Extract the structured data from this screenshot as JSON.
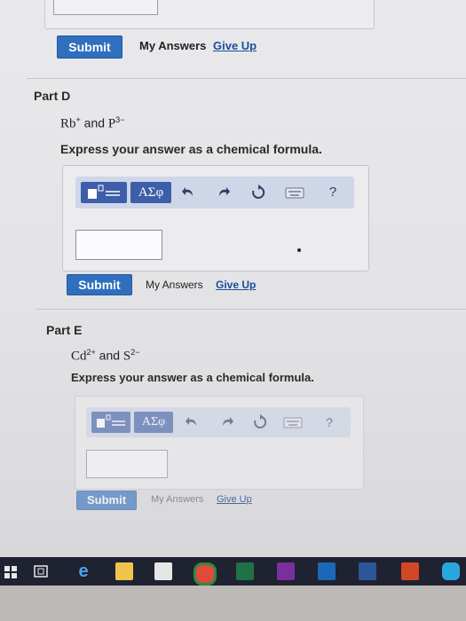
{
  "top_section": {
    "submit_label": "Submit",
    "my_answers_label": "My Answers",
    "give_up_label": "Give Up"
  },
  "part_d": {
    "title": "Part D",
    "ion1": "Rb",
    "ion1_charge": "+",
    "and": "and",
    "ion2": "P",
    "ion2_charge": "3−",
    "prompt": "Express your answer as a chemical formula.",
    "greek_label": "ΑΣφ",
    "help_label": "?",
    "submit_label": "Submit",
    "my_answers_label": "My Answers",
    "give_up_label": "Give Up"
  },
  "part_e": {
    "title": "Part E",
    "ion1": "Cd",
    "ion1_charge": "2+",
    "and": "and",
    "ion2": "S",
    "ion2_charge": "2−",
    "prompt": "Express your answer as a chemical formula.",
    "greek_label": "ΑΣφ",
    "help_label": "?",
    "submit_label": "Submit",
    "my_answers_label": "My Answers",
    "give_up_label": "Give Up"
  },
  "taskbar": {
    "icons": [
      "windows-start-icon",
      "task-view-icon",
      "edge-icon",
      "file-explorer-icon",
      "store-icon",
      "chrome-icon",
      "excel-icon",
      "onenote-icon",
      "outlook-icon",
      "word-icon",
      "powerpoint-icon",
      "skype-icon"
    ]
  },
  "colors": {
    "accent": "#2f6fbe",
    "toolbar": "#cfd6e8",
    "template_button": "#3d5ea8",
    "taskbar": "#1f2230"
  }
}
